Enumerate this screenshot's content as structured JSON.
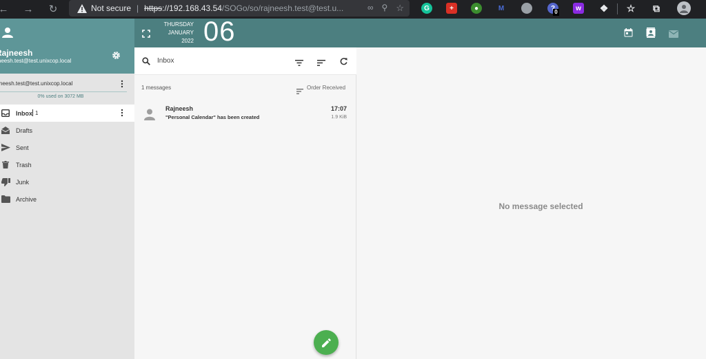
{
  "browser": {
    "security_label": "Not secure",
    "url_scheme": "https",
    "url_rest_host": "://192.168.43.54",
    "url_path": "/SOGo/so/rajneesh.test@test.u...",
    "badge_count": "0"
  },
  "header": {
    "weekday": "THURSDAY",
    "month": "JANUARY",
    "year": "2022",
    "day": "06"
  },
  "account": {
    "user_name": "Rajneesh",
    "user_email": "rajneesh.test@test.unixcop.local",
    "mailbox_address": "rajneesh.test@test.unixcop.local",
    "quota": "0% used on 3072 MB"
  },
  "folders": [
    {
      "label": "Inbox",
      "count": "1",
      "icon": "inbox-icon"
    },
    {
      "label": "Drafts",
      "icon": "drafts-icon"
    },
    {
      "label": "Sent",
      "icon": "send-icon"
    },
    {
      "label": "Trash",
      "icon": "trash-icon"
    },
    {
      "label": "Junk",
      "icon": "thumb-down-icon"
    },
    {
      "label": "Archive",
      "icon": "folder-icon"
    }
  ],
  "message_list": {
    "search_placeholder": "Inbox",
    "count_label": "1 messages",
    "sort_label": "Order Received",
    "messages": [
      {
        "sender": "Rajneesh",
        "subject": "\"Personal Calendar\" has been created",
        "time": "17:07",
        "size": "1.9 KiB"
      }
    ]
  },
  "reading_pane": {
    "empty_label": "No message selected"
  },
  "colors": {
    "header_bg": "#4c7f80",
    "sidebar_head_bg": "#5e9698",
    "fab_bg": "#4caf50"
  }
}
